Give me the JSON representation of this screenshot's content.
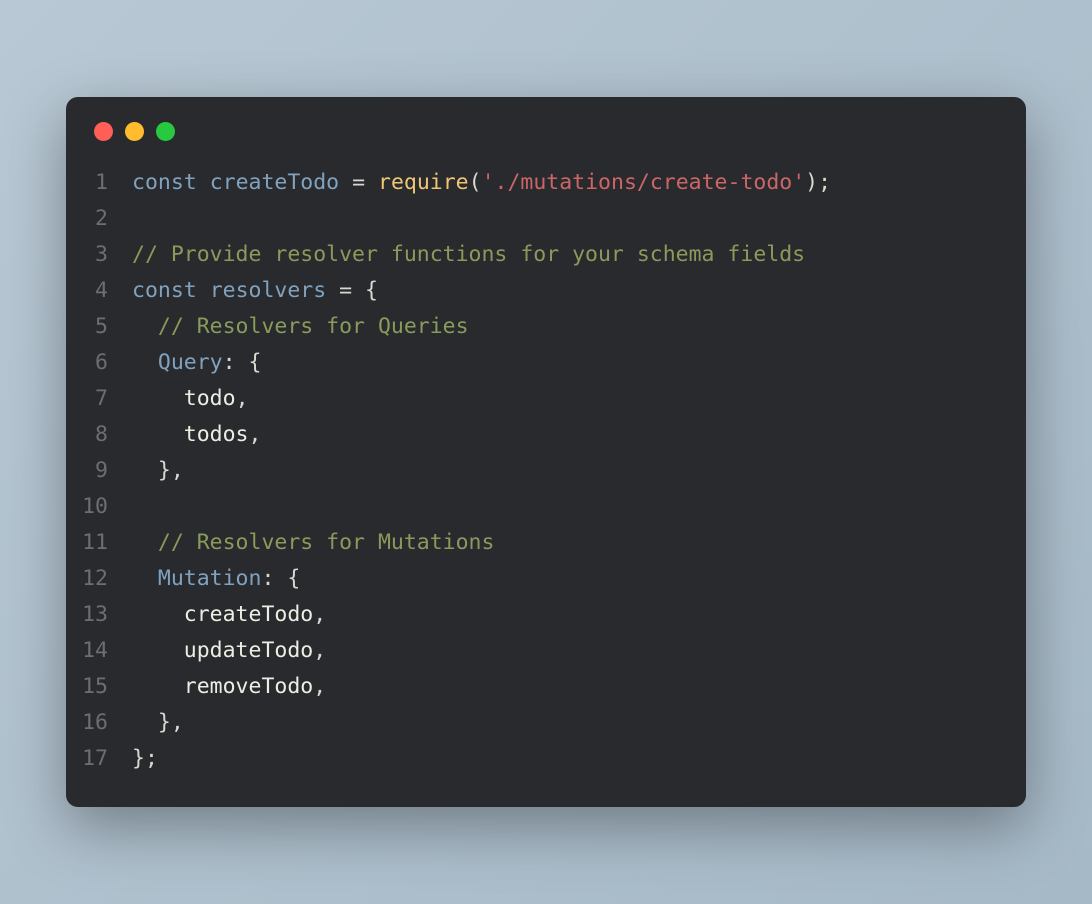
{
  "window": {
    "traffic_lights": [
      "red",
      "yellow",
      "green"
    ]
  },
  "code": {
    "lines": [
      {
        "num": "1",
        "tokens": [
          {
            "cls": "tok-keyword",
            "t": "const"
          },
          {
            "cls": "tok-punct",
            "t": " "
          },
          {
            "cls": "tok-def",
            "t": "createTodo"
          },
          {
            "cls": "tok-punct",
            "t": " "
          },
          {
            "cls": "tok-op",
            "t": "="
          },
          {
            "cls": "tok-punct",
            "t": " "
          },
          {
            "cls": "tok-func",
            "t": "require"
          },
          {
            "cls": "tok-punct",
            "t": "("
          },
          {
            "cls": "tok-string",
            "t": "'./mutations/create-todo'"
          },
          {
            "cls": "tok-punct",
            "t": ");"
          }
        ]
      },
      {
        "num": "2",
        "tokens": []
      },
      {
        "num": "3",
        "tokens": [
          {
            "cls": "tok-comment",
            "t": "// Provide resolver functions for your schema fields"
          }
        ]
      },
      {
        "num": "4",
        "tokens": [
          {
            "cls": "tok-keyword",
            "t": "const"
          },
          {
            "cls": "tok-punct",
            "t": " "
          },
          {
            "cls": "tok-def",
            "t": "resolvers"
          },
          {
            "cls": "tok-punct",
            "t": " "
          },
          {
            "cls": "tok-op",
            "t": "="
          },
          {
            "cls": "tok-punct",
            "t": " {"
          }
        ]
      },
      {
        "num": "5",
        "tokens": [
          {
            "cls": "tok-punct",
            "t": "  "
          },
          {
            "cls": "tok-comment",
            "t": "// Resolvers for Queries"
          }
        ]
      },
      {
        "num": "6",
        "tokens": [
          {
            "cls": "tok-punct",
            "t": "  "
          },
          {
            "cls": "tok-prop",
            "t": "Query"
          },
          {
            "cls": "tok-punct",
            "t": ": {"
          }
        ]
      },
      {
        "num": "7",
        "tokens": [
          {
            "cls": "tok-punct",
            "t": "    "
          },
          {
            "cls": "tok-ident",
            "t": "todo"
          },
          {
            "cls": "tok-punct",
            "t": ","
          }
        ]
      },
      {
        "num": "8",
        "tokens": [
          {
            "cls": "tok-punct",
            "t": "    "
          },
          {
            "cls": "tok-ident",
            "t": "todos"
          },
          {
            "cls": "tok-punct",
            "t": ","
          }
        ]
      },
      {
        "num": "9",
        "tokens": [
          {
            "cls": "tok-punct",
            "t": "  },"
          }
        ]
      },
      {
        "num": "10",
        "tokens": []
      },
      {
        "num": "11",
        "tokens": [
          {
            "cls": "tok-punct",
            "t": "  "
          },
          {
            "cls": "tok-comment",
            "t": "// Resolvers for Mutations"
          }
        ]
      },
      {
        "num": "12",
        "tokens": [
          {
            "cls": "tok-punct",
            "t": "  "
          },
          {
            "cls": "tok-prop",
            "t": "Mutation"
          },
          {
            "cls": "tok-punct",
            "t": ": {"
          }
        ]
      },
      {
        "num": "13",
        "tokens": [
          {
            "cls": "tok-punct",
            "t": "    "
          },
          {
            "cls": "tok-ident",
            "t": "createTodo"
          },
          {
            "cls": "tok-punct",
            "t": ","
          }
        ]
      },
      {
        "num": "14",
        "tokens": [
          {
            "cls": "tok-punct",
            "t": "    "
          },
          {
            "cls": "tok-ident",
            "t": "updateTodo"
          },
          {
            "cls": "tok-punct",
            "t": ","
          }
        ]
      },
      {
        "num": "15",
        "tokens": [
          {
            "cls": "tok-punct",
            "t": "    "
          },
          {
            "cls": "tok-ident",
            "t": "removeTodo"
          },
          {
            "cls": "tok-punct",
            "t": ","
          }
        ]
      },
      {
        "num": "16",
        "tokens": [
          {
            "cls": "tok-punct",
            "t": "  },"
          }
        ]
      },
      {
        "num": "17",
        "tokens": [
          {
            "cls": "tok-punct",
            "t": "};"
          }
        ]
      }
    ]
  }
}
